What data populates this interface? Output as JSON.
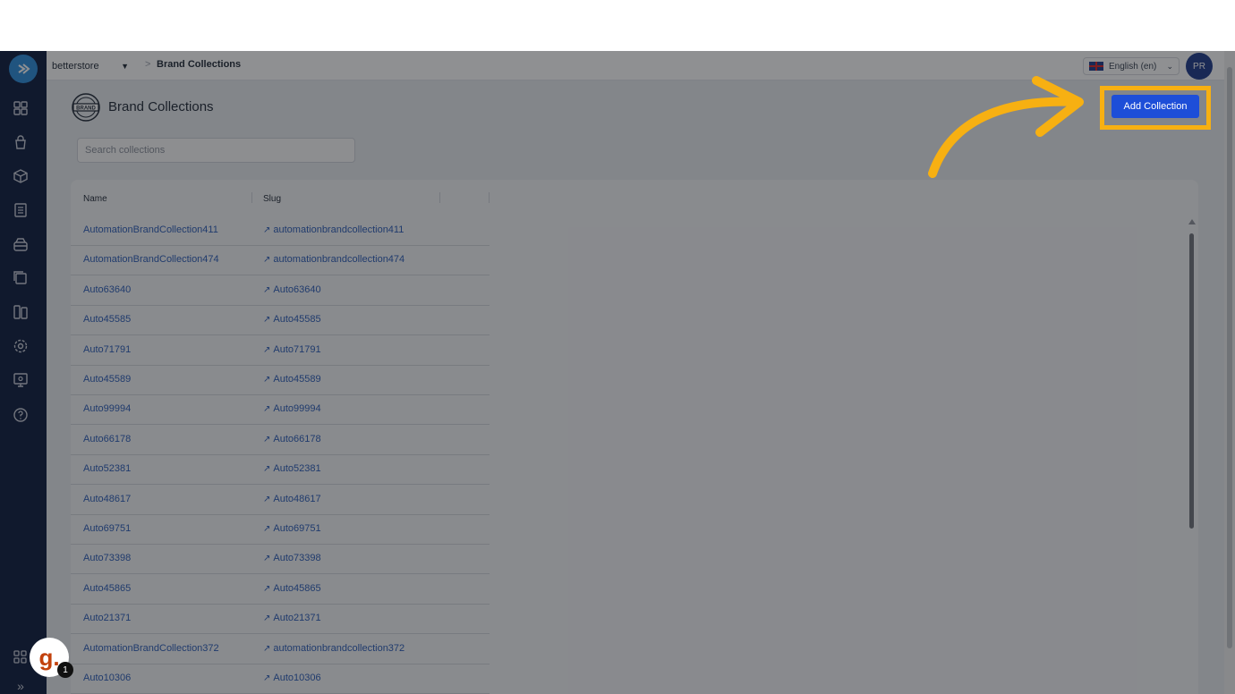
{
  "topbar": {
    "store": "betterstore",
    "breadcrumb_sep": ">",
    "breadcrumb_current": "Brand Collections",
    "language": "English (en)",
    "avatar_initials": "PR"
  },
  "header": {
    "badge_text": "BRAND",
    "title": "Brand Collections",
    "add_button": "Add Collection"
  },
  "search": {
    "placeholder": "Search collections"
  },
  "table": {
    "columns": [
      "Name",
      "Slug"
    ],
    "rows": [
      {
        "name": "AutomationBrandCollection411",
        "slug": "automationbrandcollection411"
      },
      {
        "name": "AutomationBrandCollection474",
        "slug": "automationbrandcollection474"
      },
      {
        "name": "Auto63640",
        "slug": "Auto63640"
      },
      {
        "name": "Auto45585",
        "slug": "Auto45585"
      },
      {
        "name": "Auto71791",
        "slug": "Auto71791"
      },
      {
        "name": "Auto45589",
        "slug": "Auto45589"
      },
      {
        "name": "Auto99994",
        "slug": "Auto99994"
      },
      {
        "name": "Auto66178",
        "slug": "Auto66178"
      },
      {
        "name": "Auto52381",
        "slug": "Auto52381"
      },
      {
        "name": "Auto48617",
        "slug": "Auto48617"
      },
      {
        "name": "Auto69751",
        "slug": "Auto69751"
      },
      {
        "name": "Auto73398",
        "slug": "Auto73398"
      },
      {
        "name": "Auto45865",
        "slug": "Auto45865"
      },
      {
        "name": "Auto21371",
        "slug": "Auto21371"
      },
      {
        "name": "AutomationBrandCollection372",
        "slug": "automationbrandcollection372"
      },
      {
        "name": "Auto10306",
        "slug": "Auto10306"
      }
    ]
  },
  "widget": {
    "letter": "g.",
    "count": "1"
  },
  "colors": {
    "sidebar": "#0d1b3e",
    "accent": "#1d4ed8",
    "highlight": "#f7b012",
    "link": "#2b5db8"
  },
  "icons": [
    "dashboard-icon",
    "orders-icon",
    "products-icon",
    "catalog-icon",
    "inventory-icon",
    "collections-icon",
    "content-icon",
    "settings-icon",
    "monitor-icon",
    "help-icon",
    "apps-icon",
    "expand-icon"
  ]
}
